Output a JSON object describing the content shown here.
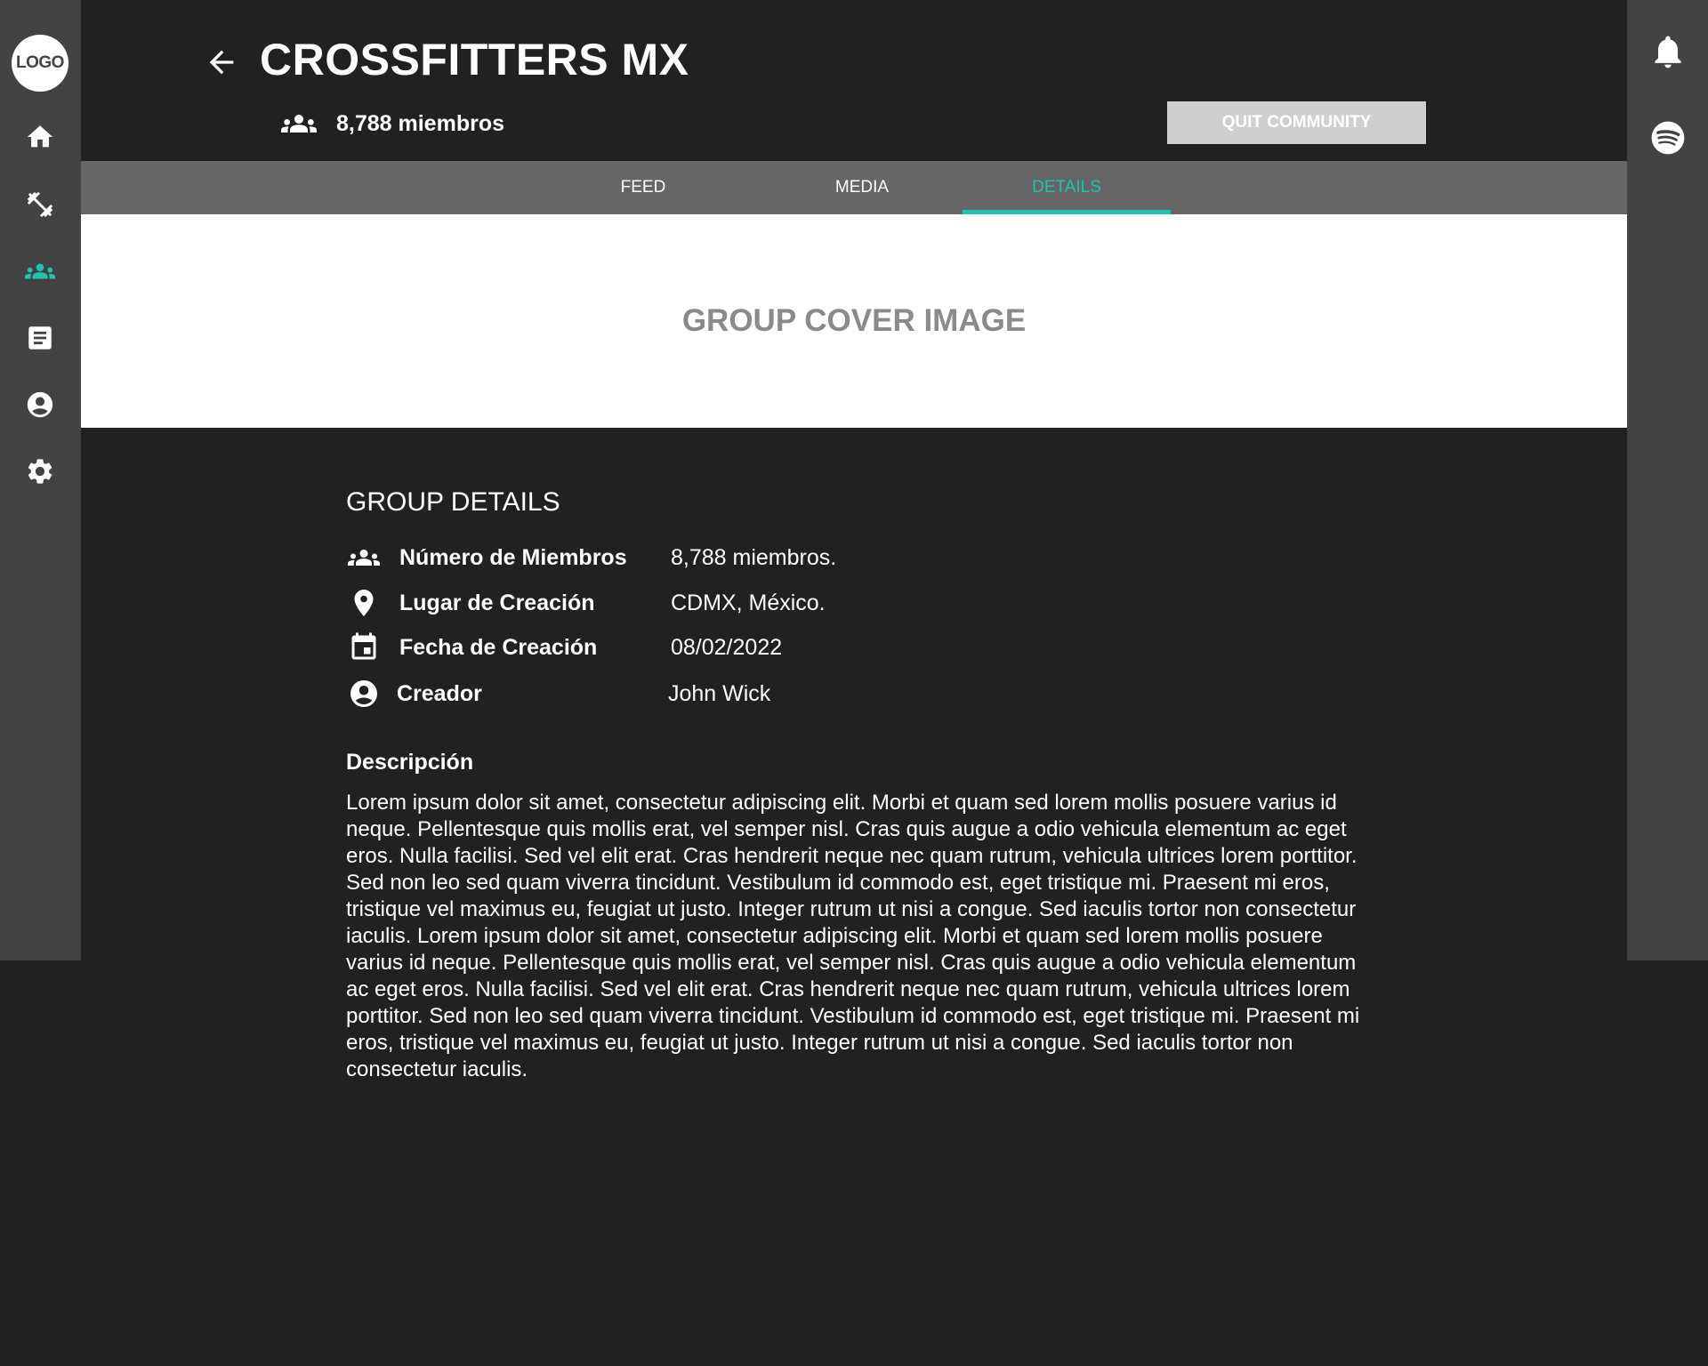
{
  "sidebar_left": {
    "logo_text": "LOGO",
    "items": [
      {
        "icon": "home-icon",
        "active": false
      },
      {
        "icon": "dumbbell-icon",
        "active": false
      },
      {
        "icon": "community-icon",
        "active": true
      },
      {
        "icon": "document-icon",
        "active": false
      },
      {
        "icon": "account-icon",
        "active": false
      },
      {
        "icon": "settings-icon",
        "active": false
      }
    ]
  },
  "sidebar_right": {
    "items": [
      {
        "icon": "bell-icon"
      },
      {
        "icon": "spotify-icon"
      }
    ]
  },
  "header": {
    "title": "CROSSFITTERS MX",
    "members_count": "8,788 miembros",
    "quit_button": "QUIT COMMUNITY"
  },
  "tabs": [
    {
      "label": "FEED",
      "active": false
    },
    {
      "label": "MEDIA",
      "active": false
    },
    {
      "label": "DETAILS",
      "active": true
    }
  ],
  "cover": {
    "placeholder": "GROUP COVER IMAGE"
  },
  "details": {
    "title": "GROUP DETAILS",
    "rows": [
      {
        "icon": "group-icon",
        "label": "Número de Miembros",
        "value": "8,788 miembros."
      },
      {
        "icon": "location-pin-icon",
        "label": "Lugar de Creación",
        "value": "CDMX, México."
      },
      {
        "icon": "calendar-icon",
        "label": "Fecha de Creación",
        "value": "08/02/2022"
      },
      {
        "icon": "account-circle-icon",
        "label": "Creador",
        "value": "John Wick"
      }
    ],
    "description_title": "Descripción",
    "description": "Lorem ipsum dolor sit amet, consectetur adipiscing elit. Morbi et quam sed lorem mollis posuere varius id neque. Pellentesque quis mollis erat, vel semper nisl. Cras quis augue a odio vehicula elementum ac eget eros. Nulla facilisi. Sed vel elit erat. Cras hendrerit neque nec quam rutrum, vehicula ultrices lorem porttitor. Sed non leo sed quam viverra tincidunt. Vestibulum id commodo est, eget tristique mi. Praesent mi eros, tristique vel maximus eu, feugiat ut justo. Integer rutrum ut nisi a congue. Sed iaculis tortor non consectetur iaculis. Lorem ipsum dolor sit amet, consectetur adipiscing elit. Morbi et quam sed lorem mollis posuere varius id neque. Pellentesque quis mollis erat, vel semper nisl. Cras quis augue a odio vehicula elementum ac eget eros. Nulla facilisi. Sed vel elit erat. Cras hendrerit neque nec quam rutrum, vehicula ultrices lorem porttitor. Sed non leo sed quam viverra tincidunt. Vestibulum id commodo est, eget tristique mi. Praesent mi eros, tristique vel maximus eu, feugiat ut justo. Integer rutrum ut nisi a congue. Sed iaculis tortor non consectetur iaculis."
  },
  "colors": {
    "accent": "#20c2b0",
    "sidebar": "#434343",
    "background": "#212121",
    "tabbar": "#666666",
    "button": "#cfcfcf"
  }
}
